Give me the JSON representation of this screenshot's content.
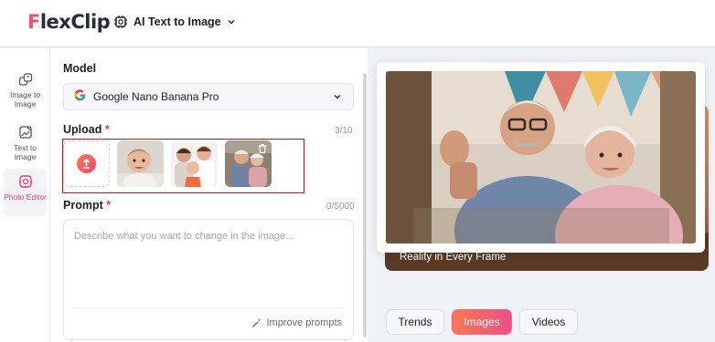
{
  "header": {
    "logo_text": "lexClip",
    "logo_initial": "F",
    "tool_title": "AI Text to Image"
  },
  "sidebar": {
    "items": [
      {
        "label": "Image to Image",
        "icon": "image-to-image-icon",
        "active": false
      },
      {
        "label": "Text to Image",
        "icon": "text-to-image-icon",
        "active": false
      },
      {
        "label": "Photo Editor",
        "icon": "photo-editor-icon",
        "active": true
      }
    ]
  },
  "model": {
    "label": "Model",
    "selected": "Google Nano Banana Pro",
    "icon": "google-icon"
  },
  "upload": {
    "label": "Upload",
    "required_mark": "*",
    "count": "3/10",
    "thumbnails": [
      "baby-photo",
      "family-photo",
      "elderly-couple-photo"
    ]
  },
  "prompt": {
    "label": "Prompt",
    "required_mark": "*",
    "count": "0/5000",
    "placeholder": "Describe what you want to change in the image...",
    "improve_label": "Improve prompts"
  },
  "preview": {
    "caption": "Reality in Every Frame"
  },
  "tabs": [
    {
      "label": "Trends",
      "active": false
    },
    {
      "label": "Images",
      "active": true
    },
    {
      "label": "Videos",
      "active": false
    }
  ],
  "colors": {
    "accent": "#ef4f86",
    "highlight_border": "#a01d22",
    "required": "#e33a4a"
  }
}
